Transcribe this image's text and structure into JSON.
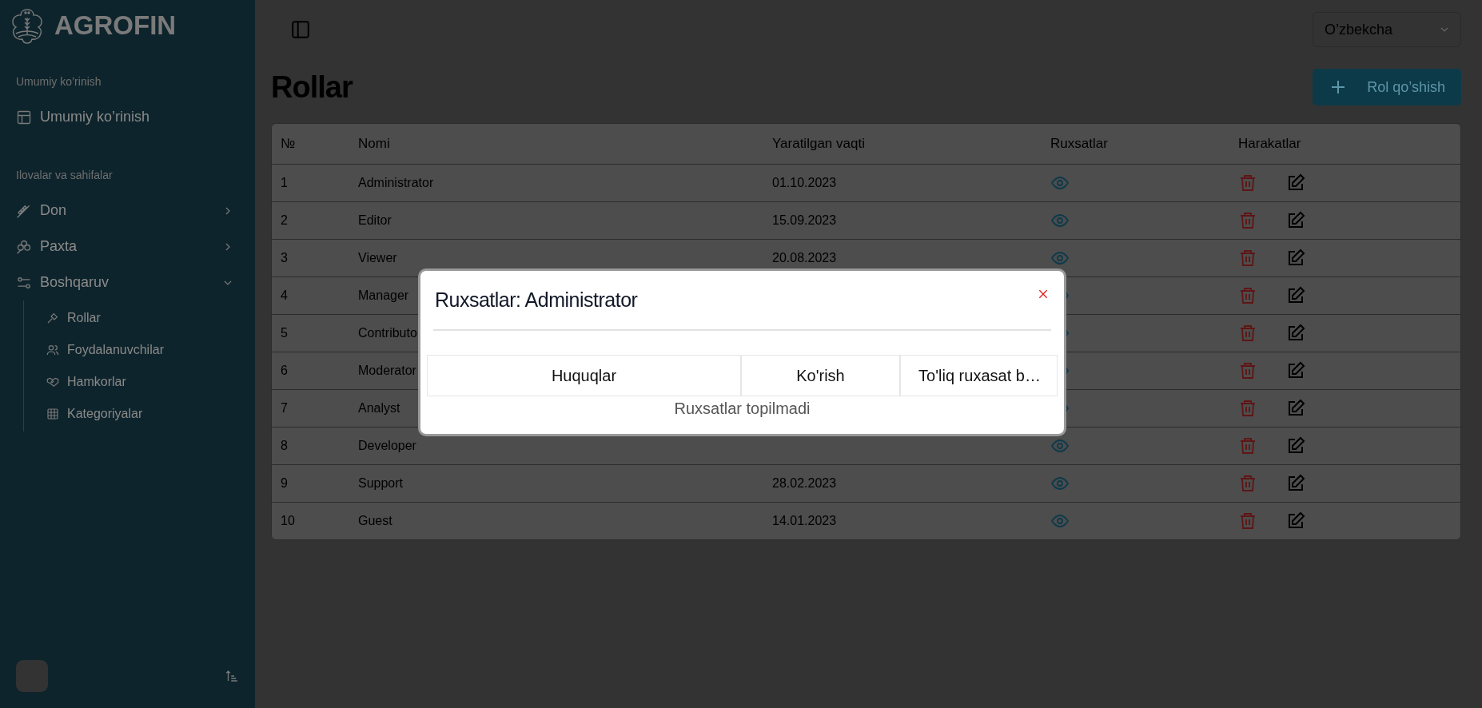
{
  "sidebar": {
    "brand": "AGROFIN",
    "sections": [
      {
        "title": "Umumiy ko’rinish",
        "items": [
          {
            "label": "Umumiy ko’rinish"
          }
        ]
      },
      {
        "title": "Ilovalar va sahifalar",
        "items": [
          {
            "label": "Don",
            "expanded": false
          },
          {
            "label": "Paxta",
            "expanded": false
          },
          {
            "label": "Boshqaruv",
            "expanded": true,
            "children": [
              {
                "label": "Rollar"
              },
              {
                "label": "Foydalanuvchilar"
              },
              {
                "label": "Hamkorlar"
              },
              {
                "label": "Kategoriyalar"
              }
            ]
          }
        ]
      }
    ]
  },
  "header": {
    "language": "O’zbekcha",
    "title": "Rollar",
    "add_button": "Rol qo’shish"
  },
  "table": {
    "columns": [
      "№",
      "Nomi",
      "Yaratilgan vaqti",
      "Ruxsatlar",
      "Harakatlar"
    ],
    "rows": [
      {
        "number": "1",
        "name": "Administrator",
        "created": "01.10.2023"
      },
      {
        "number": "2",
        "name": "Editor",
        "created": "15.09.2023"
      },
      {
        "number": "3",
        "name": "Viewer",
        "created": "20.08.2023"
      },
      {
        "number": "4",
        "name": "Manager"
      },
      {
        "number": "5",
        "name": "Contributo"
      },
      {
        "number": "6",
        "name": "Moderator"
      },
      {
        "number": "7",
        "name": "Analyst"
      },
      {
        "number": "8",
        "name": "Developer"
      },
      {
        "number": "9",
        "name": "Support",
        "created": "28.02.2023"
      },
      {
        "number": "10",
        "name": "Guest",
        "created": "14.01.2023"
      }
    ]
  },
  "modal": {
    "title": "Ruxsatlar: Administrator",
    "columns": [
      "Huquqlar",
      "Ko'rish",
      "To'liq ruxasat b…"
    ],
    "empty_message": "Ruxsatlar topilmadi"
  }
}
